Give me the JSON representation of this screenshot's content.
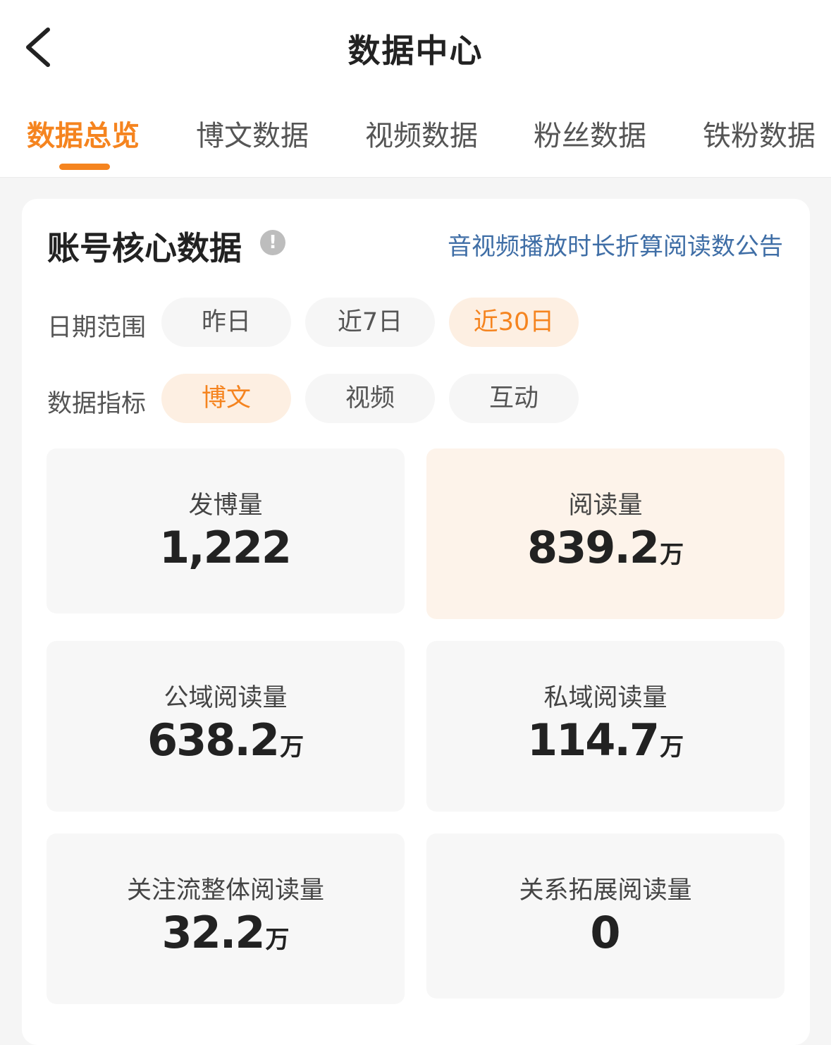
{
  "header": {
    "title": "数据中心"
  },
  "tabs": [
    {
      "label": "数据总览",
      "active": true
    },
    {
      "label": "博文数据",
      "active": false
    },
    {
      "label": "视频数据",
      "active": false
    },
    {
      "label": "粉丝数据",
      "active": false
    },
    {
      "label": "铁粉数据",
      "active": false
    }
  ],
  "card": {
    "title": "账号核心数据",
    "info_icon": "!",
    "notice_link": "音视频播放时长折算阅读数公告",
    "date_range": {
      "label": "日期范围",
      "options": [
        "昨日",
        "近7日",
        "近30日"
      ],
      "selected": "近30日"
    },
    "metric": {
      "label": "数据指标",
      "options": [
        "博文",
        "视频",
        "互动"
      ],
      "selected": "博文"
    },
    "stats": [
      {
        "label": "发博量",
        "value": "1,222",
        "unit": ""
      },
      {
        "label": "阅读量",
        "value": "839.2",
        "unit": "万"
      },
      {
        "label": "公域阅读量",
        "value": "638.2",
        "unit": "万"
      },
      {
        "label": "私域阅读量",
        "value": "114.7",
        "unit": "万"
      },
      {
        "label": "关注流整体阅读量",
        "value": "32.2",
        "unit": "万"
      },
      {
        "label": "关系拓展阅读量",
        "value": "0",
        "unit": ""
      }
    ]
  },
  "colors": {
    "accent": "#f5841f",
    "link": "#3f6ea6",
    "highlight_bg": "#fdf3ea"
  },
  "icons": {
    "back": "chevron-left-icon",
    "info": "info-icon"
  }
}
